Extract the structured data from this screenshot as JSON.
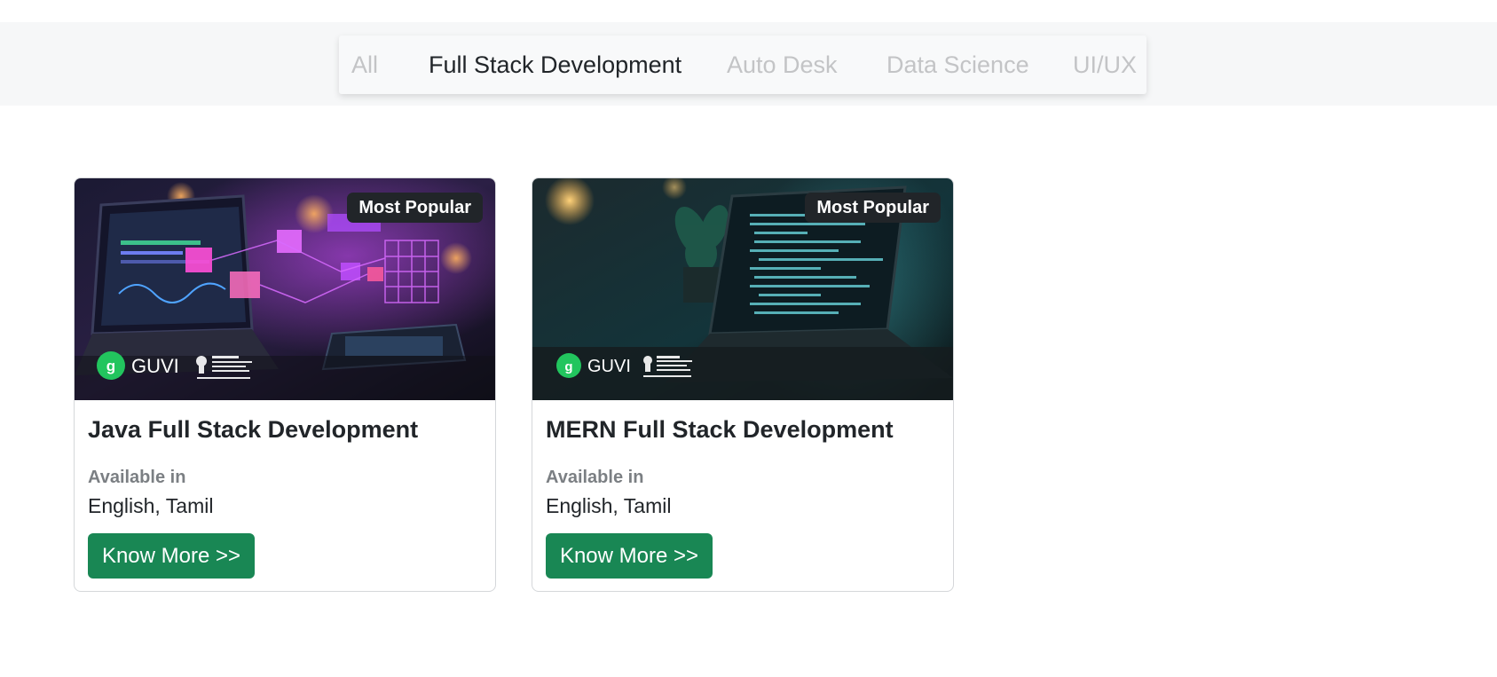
{
  "tabs": [
    {
      "label": "All",
      "active": false
    },
    {
      "label": "Full Stack Development",
      "active": true
    },
    {
      "label": "Auto Desk",
      "active": false
    },
    {
      "label": "Data Science",
      "active": false
    },
    {
      "label": "UI/UX",
      "active": false
    }
  ],
  "courses": [
    {
      "badge": "Most Popular",
      "title": "Java Full Stack Development",
      "availability_label": "Available in",
      "languages": "English, Tamil",
      "button_label": "Know More >>",
      "image_logo_text": "GUVI"
    },
    {
      "badge": "Most Popular",
      "title": "MERN Full Stack Development",
      "availability_label": "Available in",
      "languages": "English, Tamil",
      "button_label": "Know More >>",
      "image_logo_text": "GUVI"
    }
  ],
  "colors": {
    "primary_button": "#198754",
    "badge_bg": "#212529",
    "tab_active": "#212529",
    "tab_inactive": "#c3c4c6"
  }
}
